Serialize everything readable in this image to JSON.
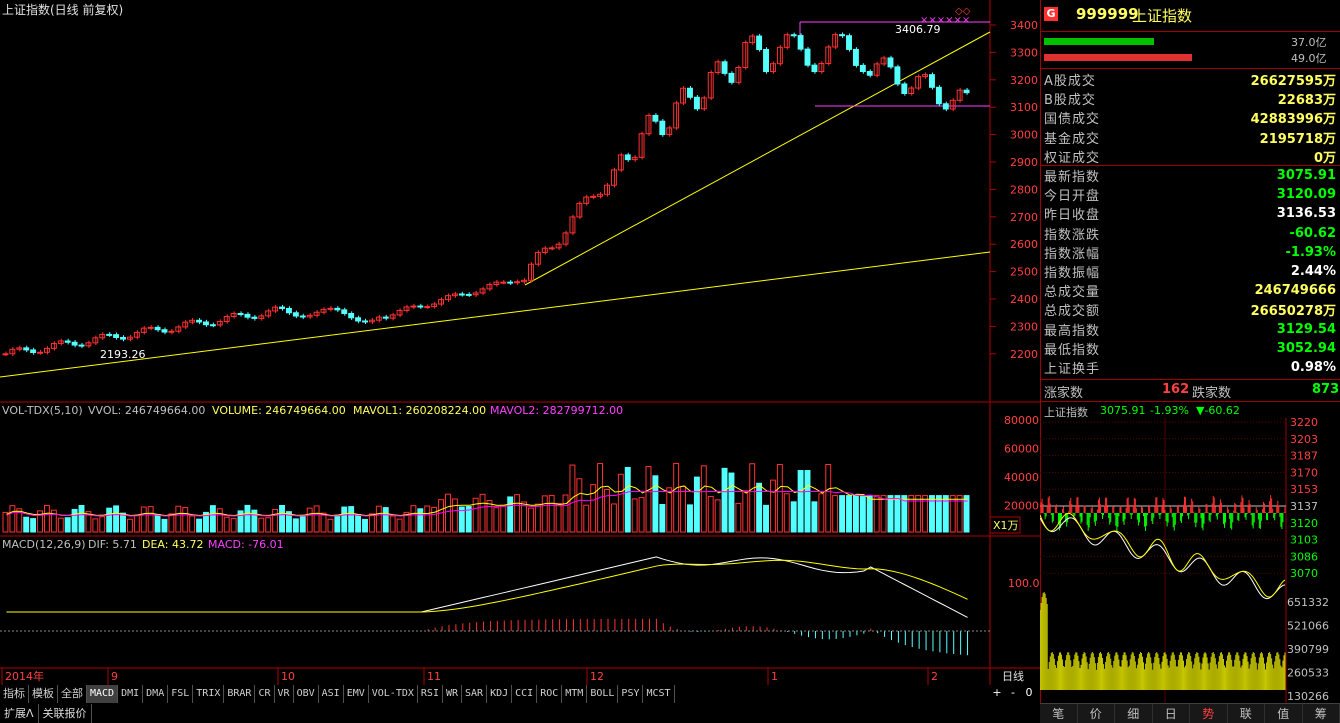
{
  "header": {
    "title": "上证指数(日线 前复权)",
    "peak_label": "3406.79",
    "trough_label": "2193.26"
  },
  "price_axis": [
    "3400",
    "3300",
    "3200",
    "3100",
    "3000",
    "2900",
    "2800",
    "2700",
    "2600",
    "2500",
    "2400",
    "2300",
    "2200"
  ],
  "vol_header": {
    "name": "VOL-TDX(5,10)",
    "vvol": "VVOL: 246749664.00",
    "volume": "VOLUME: 246749664.00",
    "mavol1": "MAVOL1: 260208224.00",
    "mavol2": "MAVOL2: 282799712.00"
  },
  "vol_axis": [
    "80000",
    "60000",
    "40000",
    "20000"
  ],
  "vol_unit": "X1万",
  "macd_header": {
    "name": "MACD(12,26,9)",
    "dif": "DIF: 5.71",
    "dea": "DEA: 43.72",
    "macd": "MACD: -76.01"
  },
  "macd_axis": [
    "100.0"
  ],
  "date_axis": [
    "2014年",
    "9",
    "10",
    "11",
    "12",
    "1",
    "2"
  ],
  "period_label": "日线",
  "zoom_buttons": [
    "+",
    "-",
    "0"
  ],
  "indicator_tabs": [
    "指标",
    "模板",
    "全部",
    "MACD",
    "DMI",
    "DMA",
    "FSL",
    "TRIX",
    "BRAR",
    "CR",
    "VR",
    "OBV",
    "ASI",
    "EMV",
    "VOL-TDX",
    "RSI",
    "WR",
    "SAR",
    "KDJ",
    "CCI",
    "ROC",
    "MTM",
    "BOLL",
    "PSY",
    "MCST"
  ],
  "bottom_tabs": [
    "扩展ᐱ",
    "关联报价"
  ],
  "quote": {
    "badge": "G",
    "code": "999999",
    "name": "上证指数",
    "buy_amount": "37.0亿",
    "sell_amount": "49.0亿",
    "rows": [
      {
        "label": "A股成交",
        "value": "26627595万",
        "color": "#ffff60"
      },
      {
        "label": "B股成交",
        "value": "22683万",
        "color": "#ffff60"
      },
      {
        "label": "国债成交",
        "value": "42883996万",
        "color": "#ffff60"
      },
      {
        "label": "基金成交",
        "value": "2195718万",
        "color": "#ffff60"
      },
      {
        "label": "权证成交",
        "value": "0万",
        "color": "#ffff60"
      },
      {
        "label": "最新指数",
        "value": "3075.91",
        "color": "#00ff00"
      },
      {
        "label": "今日开盘",
        "value": "3120.09",
        "color": "#00ff00"
      },
      {
        "label": "昨日收盘",
        "value": "3136.53",
        "color": "#ffffff"
      },
      {
        "label": "指数涨跌",
        "value": "-60.62",
        "color": "#00ff00"
      },
      {
        "label": "指数涨幅",
        "value": "-1.93%",
        "color": "#00ff00"
      },
      {
        "label": "指数振幅",
        "value": "2.44%",
        "color": "#ffffff"
      },
      {
        "label": "总成交量",
        "value": "246749666",
        "color": "#ffff60"
      },
      {
        "label": "总成交额",
        "value": "26650278万",
        "color": "#ffff60"
      },
      {
        "label": "最高指数",
        "value": "3129.54",
        "color": "#00ff00"
      },
      {
        "label": "最低指数",
        "value": "3052.94",
        "color": "#00ff00"
      },
      {
        "label": "上证换手",
        "value": "0.98%",
        "color": "#ffffff"
      }
    ],
    "rise_label": "涨家数",
    "rise_value": "162",
    "fall_label": "跌家数",
    "fall_value": "873"
  },
  "intraday": {
    "title": "上证指数",
    "price": "3075.91",
    "pct": "-1.93%",
    "change": "▼-60.62",
    "price_axis": [
      "3220",
      "3203",
      "3187",
      "3170",
      "3153",
      "3137",
      "3120",
      "3103",
      "3086",
      "3070"
    ],
    "vol_axis": [
      "651332",
      "521066",
      "390799",
      "260533",
      "130266"
    ]
  },
  "right_tabs": [
    "笔",
    "价",
    "细",
    "日",
    "势",
    "联",
    "值",
    "筹"
  ],
  "colors": {
    "up": "#ff3232",
    "down": "#54ffff",
    "ma_white": "#ffffff",
    "ma_yellow": "#ffff00",
    "ma_magenta": "#ff00ff",
    "grid": "#8b0000"
  }
}
